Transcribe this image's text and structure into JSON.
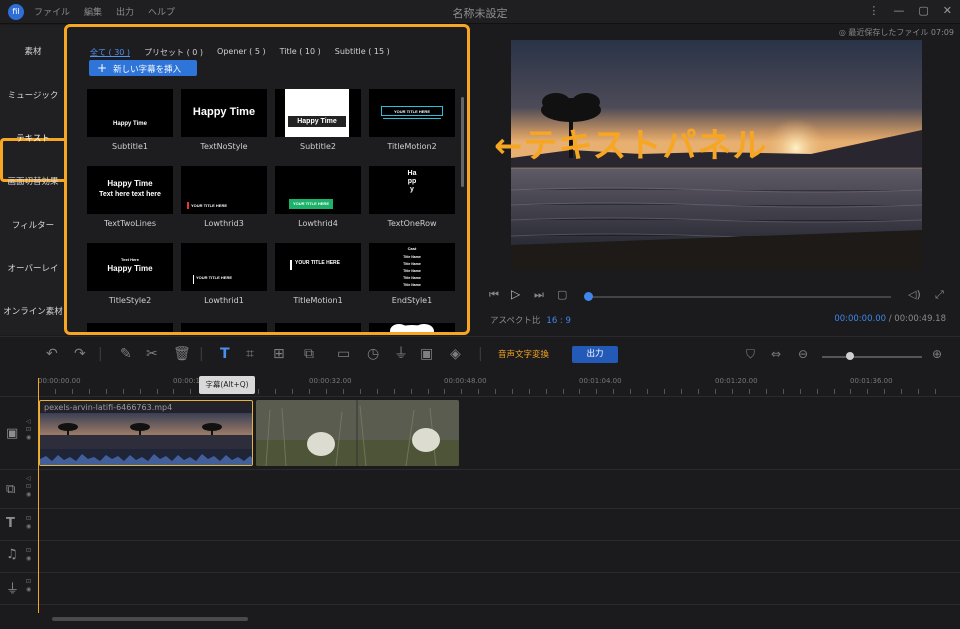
{
  "titlebar": {
    "logo": "fil",
    "menu": [
      "ファイル",
      "編集",
      "出力",
      "ヘルプ"
    ],
    "title": "名称未設定",
    "controls": [
      "more-vert-icon",
      "minimize-icon",
      "maximize-icon",
      "close-icon"
    ]
  },
  "sidebar": {
    "items": [
      {
        "label": "素材"
      },
      {
        "label": "ミュージック"
      },
      {
        "label": "テキスト",
        "active": true
      },
      {
        "label": "画面切替効果"
      },
      {
        "label": "フィルター"
      },
      {
        "label": "オーバーレイ"
      },
      {
        "label": "オンライン素材"
      }
    ]
  },
  "text_panel": {
    "tabs": [
      {
        "label": "全て ( 30 )",
        "active": true
      },
      {
        "label": "プリセット ( 0 )"
      },
      {
        "label": "Opener ( 5 )"
      },
      {
        "label": "Title ( 10 )"
      },
      {
        "label": "Subtitle ( 15 )"
      }
    ],
    "insert_button": "新しい字幕を挿入",
    "templates": [
      {
        "name": "Subtitle1",
        "preview": "Happy Time"
      },
      {
        "name": "TextNoStyle",
        "preview": "Happy Time"
      },
      {
        "name": "Subtitle2",
        "preview": "Happy Time"
      },
      {
        "name": "TitleMotion2",
        "preview": "YOUR TITLE HERE"
      },
      {
        "name": "TextTwoLines",
        "preview": "Happy Time",
        "preview2": "Text here text here"
      },
      {
        "name": "Lowthrid3",
        "preview": "YOUR TITLE HERE"
      },
      {
        "name": "Lowthrid4",
        "preview": "YOUR TITLE HERE"
      },
      {
        "name": "TextOneRow",
        "preview": "Happy"
      },
      {
        "name": "TitleStyle2",
        "preview": "Happy Time",
        "preview2": "Text Here"
      },
      {
        "name": "Lowthrid1",
        "preview": "YOUR TITLE HERE"
      },
      {
        "name": "TitleMotion1",
        "preview": "YOUR TITLE HERE"
      },
      {
        "name": "EndStyle1",
        "preview": "Cast",
        "preview2": "Title Name"
      }
    ]
  },
  "callout": "←テキストパネル",
  "preview": {
    "save_status": "最近保存したファイル 07:09",
    "aspect_label": "アスペクト比",
    "aspect_value": "16 : 9",
    "time_current": "00:00:00.00",
    "time_separator": "/",
    "time_total": "00:00:49.18",
    "progress": 0.0
  },
  "toolbar": {
    "speech_to_text": "音声文字変換",
    "export": "出力",
    "zoom_level": 0.28
  },
  "timeline": {
    "ruler": [
      "00:00:00.00",
      "00:00:1",
      "00:00:32.00",
      "00:00:48.00",
      "00:01:04.00",
      "00:01:20.00",
      "00:01:36.00"
    ],
    "tooltip": "字幕(Alt+Q)",
    "clip1_name": "pexels-arvin-latifi-6466763.mp4"
  },
  "colors": {
    "accent_orange": "#f6a623",
    "accent_blue": "#2f74d8",
    "background": "#1b1b1d"
  }
}
